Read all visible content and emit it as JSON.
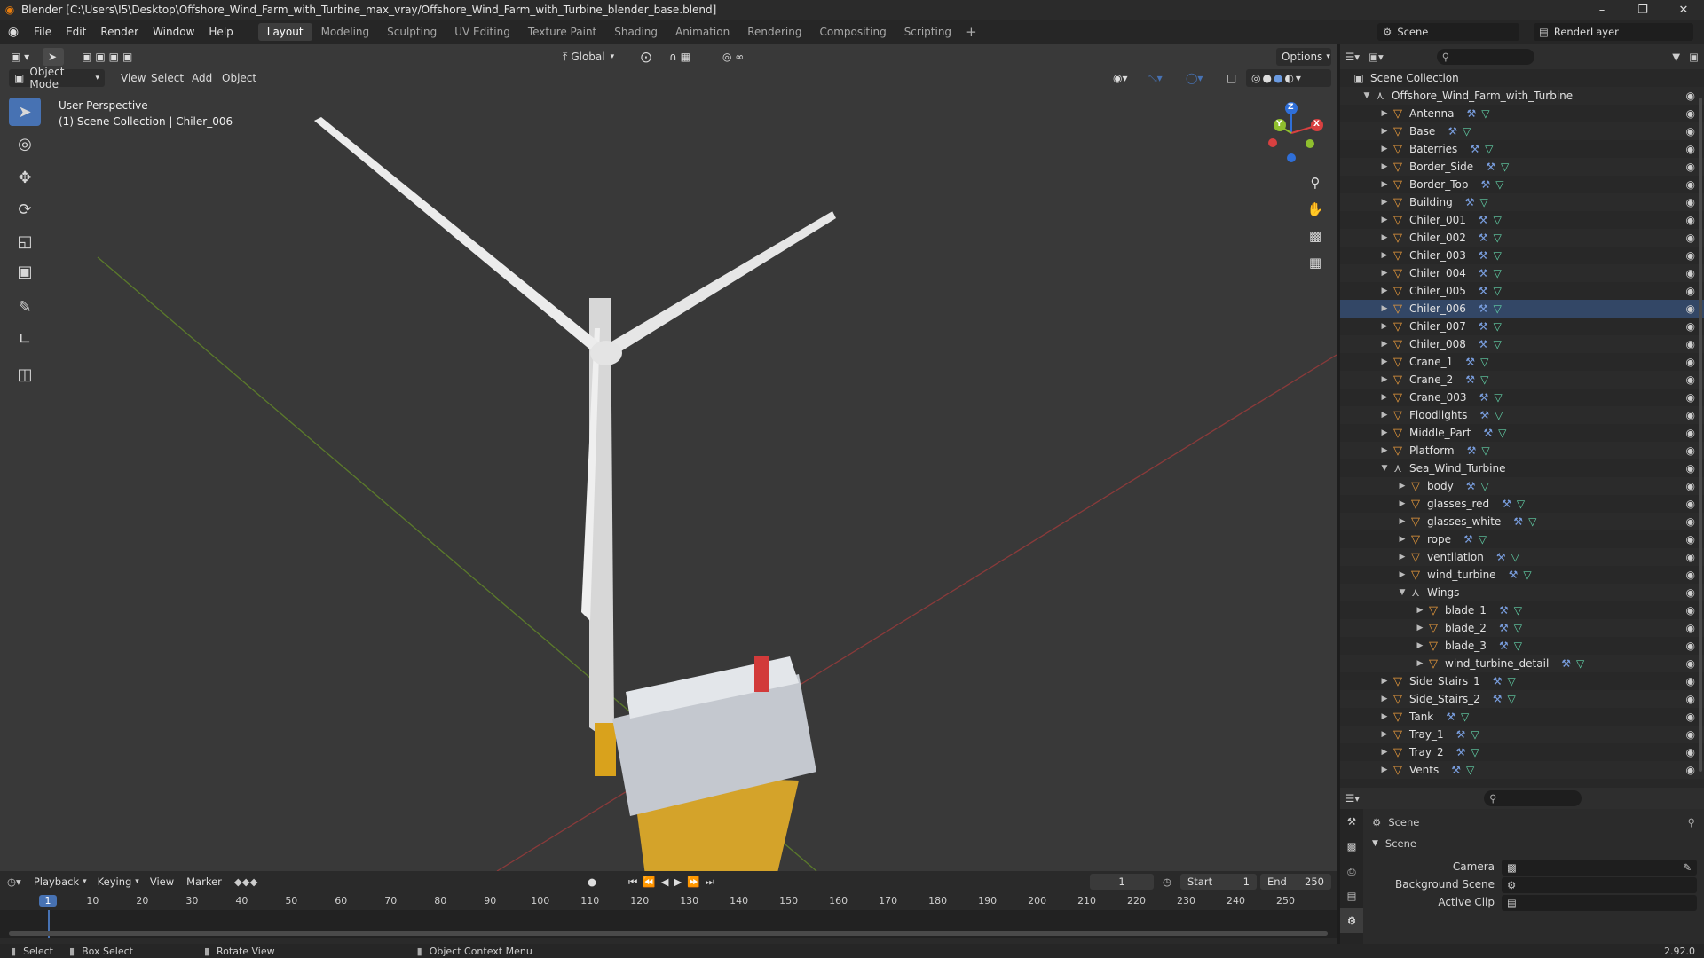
{
  "window": {
    "title": "Blender [C:\\Users\\I5\\Desktop\\Offshore_Wind_Farm_with_Turbine_max_vray/Offshore_Wind_Farm_with_Turbine_blender_base.blend]"
  },
  "menus": [
    "File",
    "Edit",
    "Render",
    "Window",
    "Help"
  ],
  "workspaces": [
    "Layout",
    "Modeling",
    "Sculpting",
    "UV Editing",
    "Texture Paint",
    "Shading",
    "Animation",
    "Rendering",
    "Compositing",
    "Scripting"
  ],
  "scene": {
    "name": "Scene",
    "render_layer": "RenderLayer"
  },
  "viewport": {
    "mode": "Object Mode",
    "menus": [
      "View",
      "Select",
      "Add",
      "Object"
    ],
    "orientation": "Global",
    "options": "Options",
    "overlay_line1": "User Perspective",
    "overlay_line2": "(1) Scene Collection | Chiler_006",
    "gizmo": {
      "x": "X",
      "y": "Y",
      "z": "Z"
    }
  },
  "outliner": {
    "root": "Scene Collection",
    "rows": [
      {
        "name": "Offshore_Wind_Farm_with_Turbine",
        "depth": 0,
        "type": "empty",
        "exp": "open"
      },
      {
        "name": "Antenna",
        "depth": 1,
        "type": "mesh",
        "exp": "closed"
      },
      {
        "name": "Base",
        "depth": 1,
        "type": "mesh",
        "exp": "closed"
      },
      {
        "name": "Baterries",
        "depth": 1,
        "type": "mesh",
        "exp": "closed"
      },
      {
        "name": "Border_Side",
        "depth": 1,
        "type": "mesh",
        "exp": "closed"
      },
      {
        "name": "Border_Top",
        "depth": 1,
        "type": "mesh",
        "exp": "closed"
      },
      {
        "name": "Building",
        "depth": 1,
        "type": "mesh",
        "exp": "closed"
      },
      {
        "name": "Chiler_001",
        "depth": 1,
        "type": "mesh",
        "exp": "closed"
      },
      {
        "name": "Chiler_002",
        "depth": 1,
        "type": "mesh",
        "exp": "closed"
      },
      {
        "name": "Chiler_003",
        "depth": 1,
        "type": "mesh",
        "exp": "closed"
      },
      {
        "name": "Chiler_004",
        "depth": 1,
        "type": "mesh",
        "exp": "closed"
      },
      {
        "name": "Chiler_005",
        "depth": 1,
        "type": "mesh",
        "exp": "closed"
      },
      {
        "name": "Chiler_006",
        "depth": 1,
        "type": "mesh",
        "exp": "closed",
        "active": true
      },
      {
        "name": "Chiler_007",
        "depth": 1,
        "type": "mesh",
        "exp": "closed"
      },
      {
        "name": "Chiler_008",
        "depth": 1,
        "type": "mesh",
        "exp": "closed"
      },
      {
        "name": "Crane_1",
        "depth": 1,
        "type": "mesh",
        "exp": "closed"
      },
      {
        "name": "Crane_2",
        "depth": 1,
        "type": "mesh",
        "exp": "closed"
      },
      {
        "name": "Crane_003",
        "depth": 1,
        "type": "mesh",
        "exp": "closed"
      },
      {
        "name": "Floodlights",
        "depth": 1,
        "type": "mesh",
        "exp": "closed"
      },
      {
        "name": "Middle_Part",
        "depth": 1,
        "type": "mesh",
        "exp": "closed"
      },
      {
        "name": "Platform",
        "depth": 1,
        "type": "mesh",
        "exp": "closed"
      },
      {
        "name": "Sea_Wind_Turbine",
        "depth": 1,
        "type": "empty",
        "exp": "open"
      },
      {
        "name": "body",
        "depth": 2,
        "type": "mesh",
        "exp": "closed"
      },
      {
        "name": "glasses_red",
        "depth": 2,
        "type": "mesh",
        "exp": "closed"
      },
      {
        "name": "glasses_white",
        "depth": 2,
        "type": "mesh",
        "exp": "closed"
      },
      {
        "name": "rope",
        "depth": 2,
        "type": "mesh",
        "exp": "closed"
      },
      {
        "name": "ventilation",
        "depth": 2,
        "type": "mesh",
        "exp": "closed"
      },
      {
        "name": "wind_turbine",
        "depth": 2,
        "type": "mesh",
        "exp": "closed"
      },
      {
        "name": "Wings",
        "depth": 2,
        "type": "empty",
        "exp": "open"
      },
      {
        "name": "blade_1",
        "depth": 3,
        "type": "mesh",
        "exp": "closed"
      },
      {
        "name": "blade_2",
        "depth": 3,
        "type": "mesh",
        "exp": "closed"
      },
      {
        "name": "blade_3",
        "depth": 3,
        "type": "mesh",
        "exp": "closed"
      },
      {
        "name": "wind_turbine_detail",
        "depth": 3,
        "type": "mesh",
        "exp": "closed"
      },
      {
        "name": "Side_Stairs_1",
        "depth": 1,
        "type": "mesh",
        "exp": "closed"
      },
      {
        "name": "Side_Stairs_2",
        "depth": 1,
        "type": "mesh",
        "exp": "closed"
      },
      {
        "name": "Tank",
        "depth": 1,
        "type": "mesh",
        "exp": "closed"
      },
      {
        "name": "Tray_1",
        "depth": 1,
        "type": "mesh",
        "exp": "closed"
      },
      {
        "name": "Tray_2",
        "depth": 1,
        "type": "mesh",
        "exp": "closed"
      },
      {
        "name": "Vents",
        "depth": 1,
        "type": "mesh",
        "exp": "closed"
      }
    ]
  },
  "properties": {
    "context": "Scene",
    "panel": "Scene",
    "camera_label": "Camera",
    "background_label": "Background Scene",
    "clip_label": "Active Clip"
  },
  "timeline": {
    "menus": [
      "Playback",
      "Keying",
      "View",
      "Marker"
    ],
    "current_frame": "1",
    "start_label": "Start",
    "start": "1",
    "end_label": "End",
    "end": "250",
    "ticks": [
      "1",
      "10",
      "20",
      "30",
      "40",
      "50",
      "60",
      "70",
      "80",
      "90",
      "100",
      "110",
      "120",
      "130",
      "140",
      "150",
      "160",
      "170",
      "180",
      "190",
      "200",
      "210",
      "220",
      "230",
      "240",
      "250"
    ]
  },
  "status": {
    "select": "Select",
    "box_select": "Box Select",
    "rotate": "Rotate View",
    "context_menu": "Object Context Menu",
    "version": "2.92.0"
  }
}
